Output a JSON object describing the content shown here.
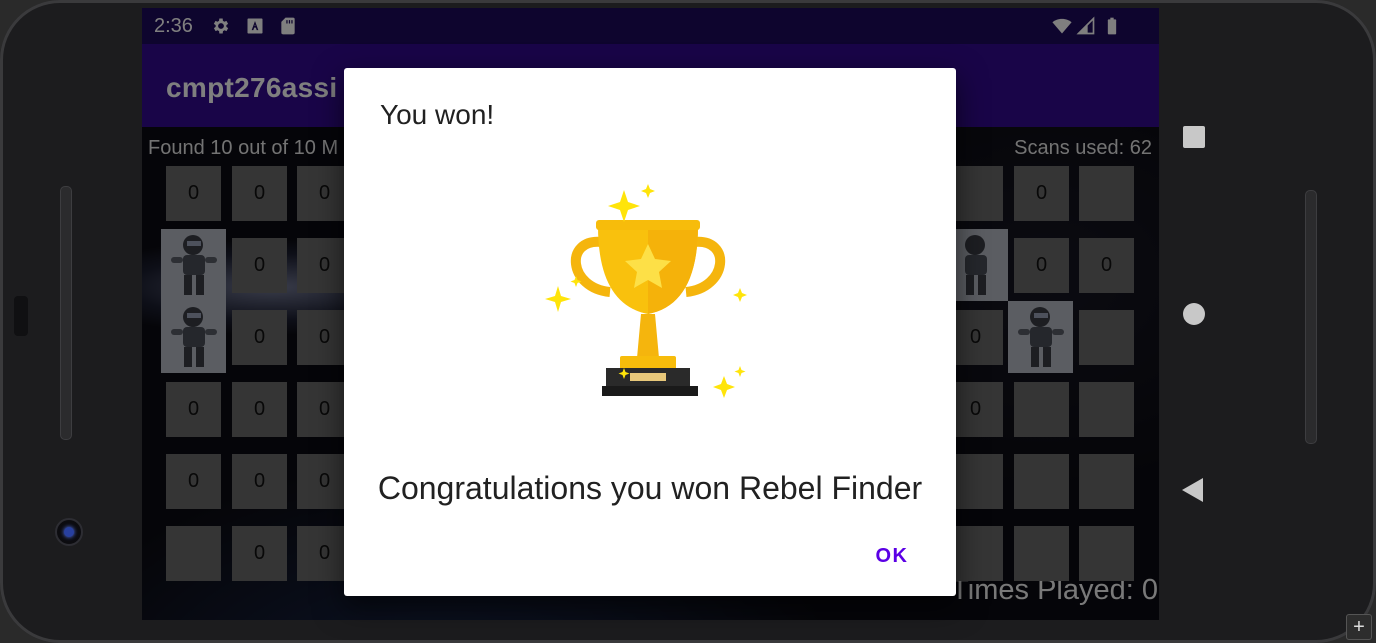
{
  "status_bar": {
    "time": "2:36",
    "left_icons": [
      "settings-icon",
      "accessibility-font-icon",
      "sd-card-icon"
    ],
    "right_icons": [
      "wifi-icon",
      "signal-icon",
      "battery-icon"
    ]
  },
  "app_bar": {
    "title": "cmpt276assi"
  },
  "game": {
    "found_text": "Found 10 out of 10 M",
    "scans_text": "Scans used: 62",
    "times_played_text": "Times Played: 0",
    "cell_values": [
      "0",
      "0",
      "0",
      "0",
      "0",
      "0",
      "0",
      "0",
      "0",
      "0",
      "0",
      "0",
      "0",
      "0",
      "0",
      "0",
      "0",
      "0",
      "0",
      "0",
      "0",
      "0",
      "0",
      "0",
      "0"
    ]
  },
  "dialog": {
    "title": "You won!",
    "message": "Congratulations you won Rebel Finder",
    "ok_label": "OK",
    "image": "trophy-icon"
  },
  "nav_bar": {
    "buttons": [
      "recents-button",
      "home-button",
      "back-button"
    ]
  },
  "colors": {
    "status_bar": "#1d0a5c",
    "app_bar": "#330b90",
    "accent": "#5b00e5",
    "cell": "#6b6b6b",
    "trophy_gold": "#f9c10d"
  }
}
